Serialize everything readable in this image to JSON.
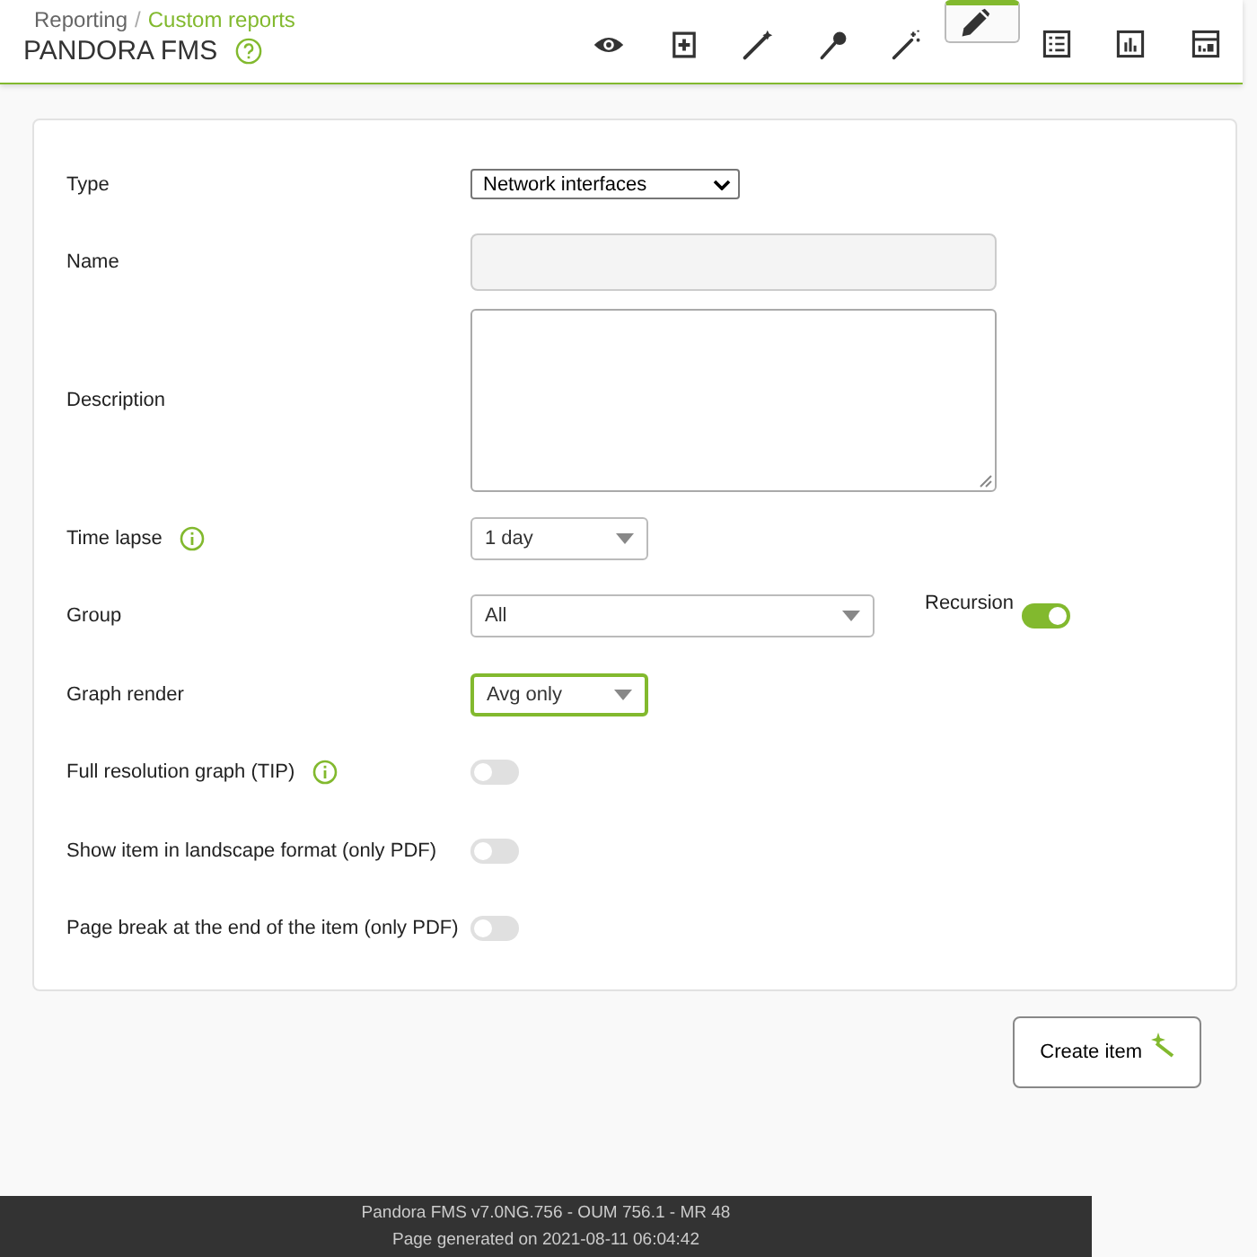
{
  "header": {
    "breadcrumb": [
      {
        "label": "Reporting",
        "kind": "plain"
      },
      {
        "label": "/",
        "kind": "separator"
      },
      {
        "label": "Custom reports",
        "kind": "link"
      }
    ],
    "title": "PANDORA FMS"
  },
  "toolbar": [
    {
      "kind": "eye",
      "selected": false
    },
    {
      "kind": "plus",
      "selected": false
    },
    {
      "kind": "wand",
      "selected": false
    },
    {
      "kind": "pin",
      "selected": false
    },
    {
      "kind": "sparkle",
      "selected": false
    },
    {
      "kind": "pencil",
      "selected": true
    },
    {
      "kind": "list",
      "selected": false
    },
    {
      "kind": "chart",
      "selected": false
    },
    {
      "kind": "panel",
      "selected": false
    }
  ],
  "form": [
    {
      "label": "Type",
      "kind": "native-select",
      "value": "Network interfaces",
      "info": false
    },
    {
      "label": "Name",
      "kind": "text",
      "info": false
    },
    {
      "label": "Description",
      "kind": "textarea",
      "info": false
    },
    {
      "label": "Time lapse",
      "kind": "select",
      "value": "1 day",
      "info": true,
      "focused": false
    },
    {
      "label": "Group",
      "kind": "wide-select",
      "value": "All",
      "info": false,
      "focused": false,
      "extra": {
        "label": "Recursion",
        "on": true
      }
    },
    {
      "label": "Graph render",
      "kind": "select",
      "value": "Avg only",
      "info": false,
      "focused": true
    },
    {
      "label": "Full resolution graph (TIP)",
      "kind": "toggle",
      "on": false,
      "info": true
    },
    {
      "label": "Show item in landscape format (only PDF)",
      "kind": "toggle",
      "on": false,
      "info": false
    },
    {
      "label": "Page break at the end of the item (only PDF)",
      "kind": "toggle",
      "on": false,
      "info": false
    }
  ],
  "create_button": "Create item",
  "footer": [
    "Pandora FMS v7.0NG.756 - OUM 756.1 - MR 48",
    "Page generated on 2021-08-11 06:04:42"
  ]
}
